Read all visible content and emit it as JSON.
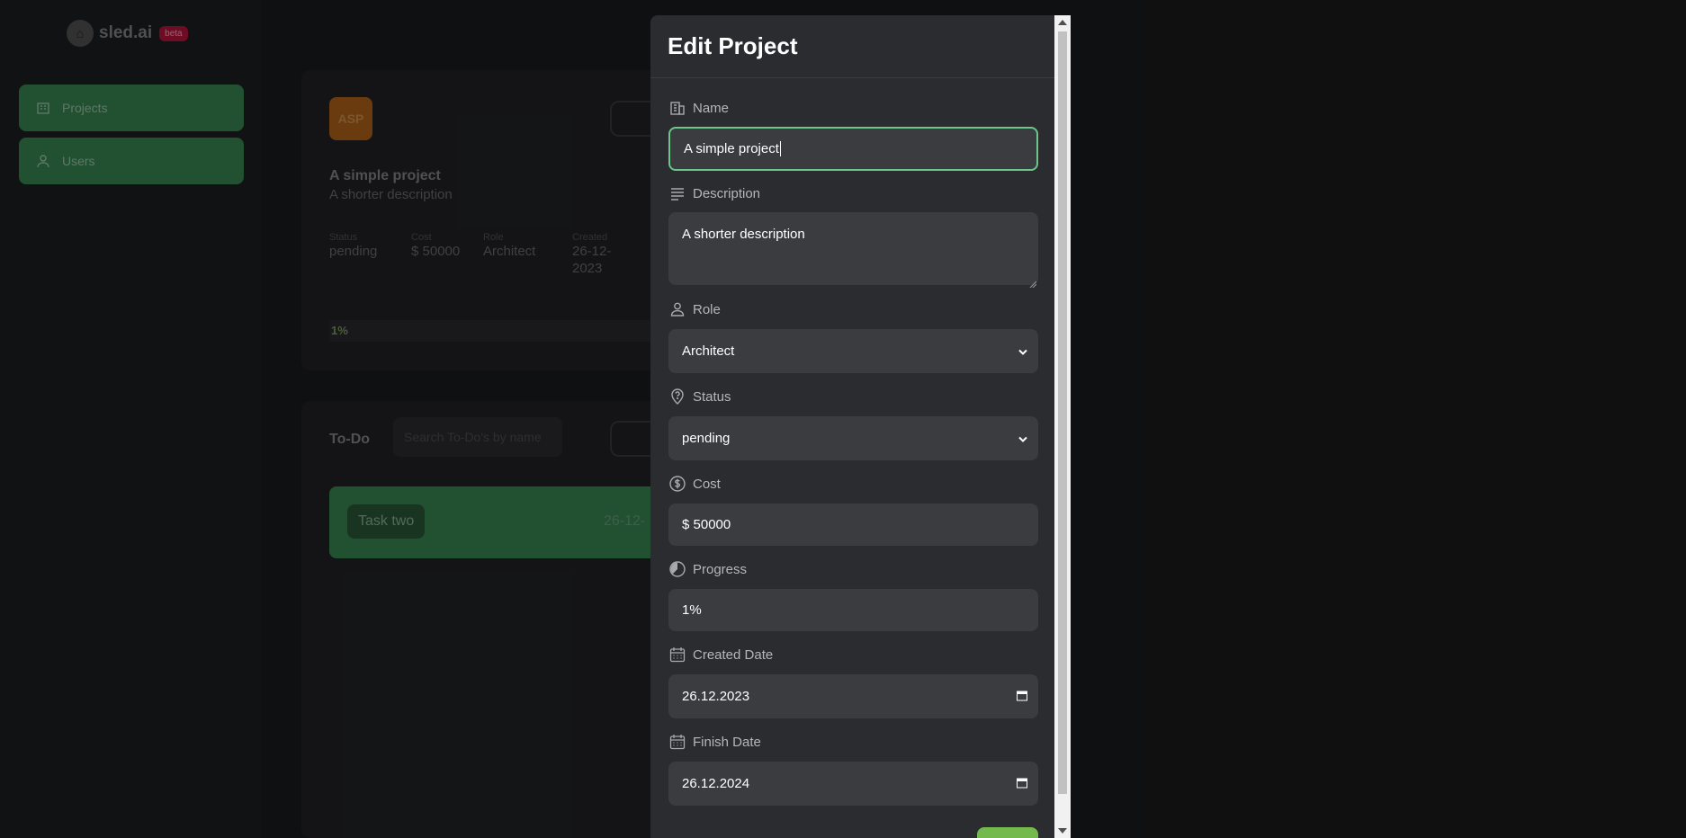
{
  "app": {
    "logo_text": "sled.ai",
    "logo_badge": "beta"
  },
  "sidebar": {
    "items": [
      {
        "label": "Projects",
        "icon": "building-icon"
      },
      {
        "label": "Users",
        "icon": "user-icon"
      }
    ]
  },
  "project": {
    "avatar_initials": "ASP",
    "title": "A simple project",
    "description": "A shorter description",
    "meta": [
      {
        "key": "Status",
        "value": "pending"
      },
      {
        "key": "Cost",
        "value": "$ 50000"
      },
      {
        "key": "Role",
        "value": "Architect"
      },
      {
        "key": "Created",
        "value": "26-12-2023"
      }
    ],
    "progress": "1%"
  },
  "todo": {
    "label": "To-Do",
    "search_placeholder": "Search To-Do's by name",
    "task": {
      "name": "Task two",
      "date": "26-12-"
    }
  },
  "modal": {
    "title": "Edit Project",
    "fields": {
      "name": {
        "label": "Name",
        "value": "A simple project"
      },
      "description": {
        "label": "Description",
        "value": "A shorter description"
      },
      "role": {
        "label": "Role",
        "value": "Architect"
      },
      "status": {
        "label": "Status",
        "value": "pending"
      },
      "cost": {
        "label": "Cost",
        "value": "$ 50000"
      },
      "progress": {
        "label": "Progress",
        "value": "1%"
      },
      "created_date": {
        "label": "Created Date",
        "value": "26.12.2023"
      },
      "finish_date": {
        "label": "Finish Date",
        "value": "26.12.2024"
      }
    }
  },
  "colors": {
    "accent_green": "#3a8c55",
    "focus_border": "#6cc58b",
    "save_button": "#74b94c",
    "badge_red": "#c0163e"
  }
}
